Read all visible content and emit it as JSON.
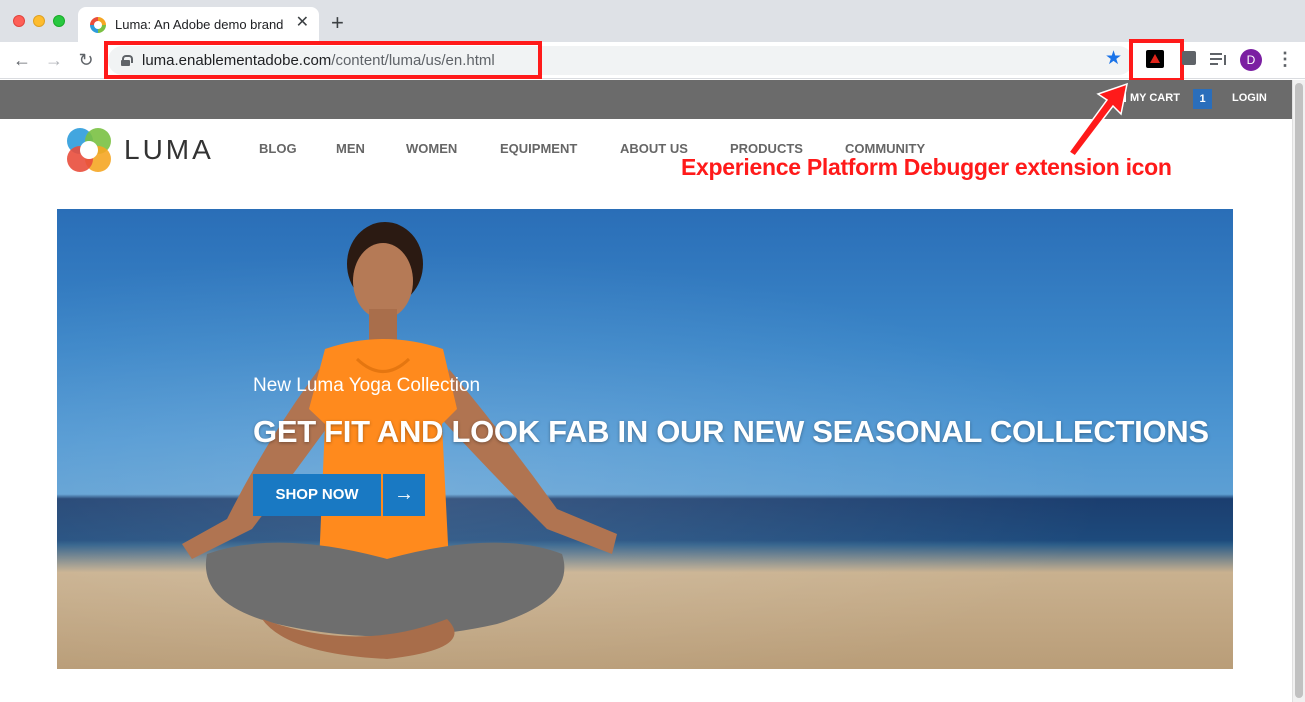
{
  "browser": {
    "tab_title": "Luma: An Adobe demo brand",
    "tab_close": "✕",
    "new_tab": "+",
    "url_host": "luma.enablementadobe.com",
    "url_path": "/content/luma/us/en.html",
    "avatar_initial": "D",
    "back": "←",
    "forward": "→",
    "reload": "↻",
    "star": "★",
    "menu": "⋮"
  },
  "site": {
    "header": {
      "cart_label": "MY CART",
      "cart_count": "1",
      "login_label": "LOGIN"
    },
    "logo_text": "LUMA",
    "nav": [
      "BLOG",
      "MEN",
      "WOMEN",
      "EQUIPMENT",
      "ABOUT US",
      "PRODUCTS",
      "COMMUNITY"
    ],
    "hero": {
      "subtitle": "New Luma Yoga Collection",
      "title": "GET FIT AND LOOK FAB IN OUR NEW SEASONAL COLLECTIONS",
      "cta_label": "SHOP NOW",
      "cta_arrow": "→"
    }
  },
  "annotation": {
    "text": "Experience Platform Debugger extension icon",
    "color": "#ff1a1a"
  },
  "colors": {
    "luma_blue": "#1979c3",
    "topbar": "#6b6b6b",
    "avatar": "#7b1fa2"
  }
}
